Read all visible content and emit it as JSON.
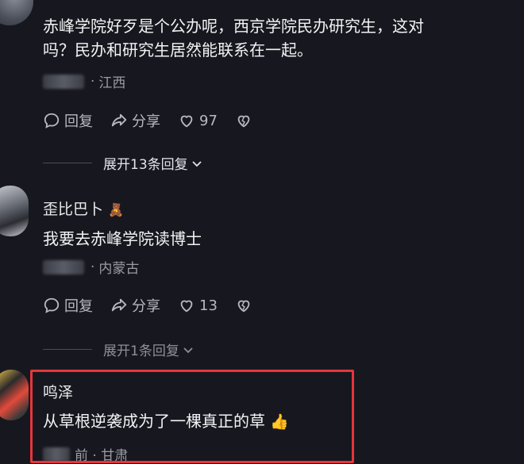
{
  "comments": [
    {
      "text_line1": "赤峰学院好歹是个公办呢，西京学院民办研究生，这对",
      "text_line2": "吗？民办和研究生居然能联系在一起。",
      "location": "江西",
      "reply_label": "回复",
      "share_label": "分享",
      "likes": "97",
      "expand_label": "展开13条回复"
    },
    {
      "username": "歪比巴卜",
      "badge": "🧸",
      "text": "我要去赤峰学院读博士",
      "location": "内蒙古",
      "reply_label": "回复",
      "share_label": "分享",
      "likes": "13",
      "expand_label": "展开1条回复"
    },
    {
      "username": "鸣泽",
      "text": "从草根逆袭成为了一棵真正的草",
      "emoji": "👍",
      "partial_meta": "前 · 甘肃"
    }
  ],
  "colors": {
    "background": "#17181f",
    "highlight_box": "#e8343b",
    "secondary_text": "#9a9ba3"
  }
}
